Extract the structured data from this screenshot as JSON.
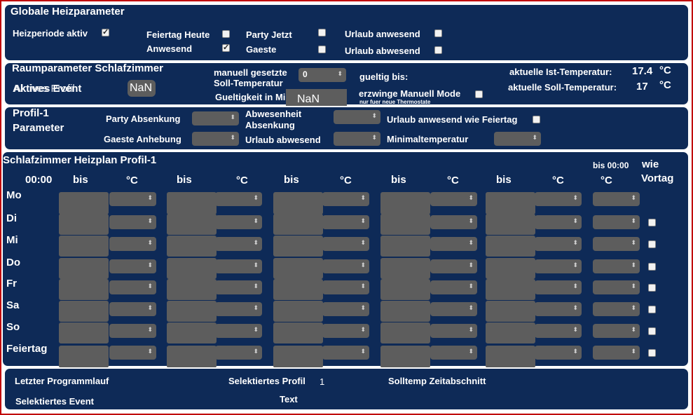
{
  "global": {
    "title": "Globale Heizparameter",
    "heizperiode": "Heizperiode aktiv",
    "feiertag_heute": "Feiertag Heute",
    "anwesend": "Anwesend",
    "party_jetzt": "Party Jetzt",
    "gaeste": "Gaeste",
    "urlaub_anwesend": "Urlaub anwesend",
    "urlaub_abwesend": "Urlaub abwesend",
    "checks": {
      "heizperiode": true,
      "feiertag_heute": false,
      "anwesend": true,
      "party_jetzt": false,
      "gaeste": false,
      "urlaub_anwesend": false,
      "urlaub_abwesend": false
    }
  },
  "room": {
    "title": "Raumparameter Schlafzimmer",
    "aktives_profil": "Aktives Profil",
    "aktives_event": "Aktives Event",
    "profil_value": "NaN",
    "manuell_label_1": "manuell gesetzte",
    "manuell_label_2": "Soll-Temperatur",
    "manuell_value": "0",
    "gueltigkeit_label": "Gueltigkeit in Min",
    "gueltigkeit_value": "NaN",
    "gueltig_bis": "gueltig bis:",
    "erzwinge": "erzwinge Manuell Mode",
    "erzwinge_note": "nur fuer neue Thermostate",
    "ist_label": "aktuelle Ist-Temperatur:",
    "ist_value": "17.4",
    "soll_label": "aktuelle Soll-Temperatur:",
    "soll_value": "17",
    "unit": "°C"
  },
  "profile": {
    "title_1": "Profil-1",
    "title_2": "Parameter",
    "party_absenkung": "Party Absenkung",
    "gaeste_anhebung": "Gaeste Anhebung",
    "abwesenheit_1": "Abwesenheit",
    "abwesenheit_2": "Absenkung",
    "urlaub_abwesend": "Urlaub abwesend",
    "urlaub_wie_feiertag": "Urlaub anwesend wie Feiertag",
    "minimaltemperatur": "Minimaltemperatur"
  },
  "schedule": {
    "title": "Schlafzimmer Heizplan Profil-1",
    "start_time": "00:00",
    "bis": "bis",
    "deg": "°C",
    "bis_end": "bis 00:00",
    "wie_1": "wie",
    "wie_2": "Vortag",
    "days": [
      "Mo",
      "Di",
      "Mi",
      "Do",
      "Fr",
      "Sa",
      "So",
      "Feiertag"
    ]
  },
  "footer": {
    "letzter": "Letzter Programmlauf",
    "selektiertes_profil": "Selektiertes Profil",
    "profil_value": "1",
    "solltemp": "Solltemp Zeitabschnitt",
    "selektiertes_event": "Selektiertes Event",
    "text": "Text"
  }
}
